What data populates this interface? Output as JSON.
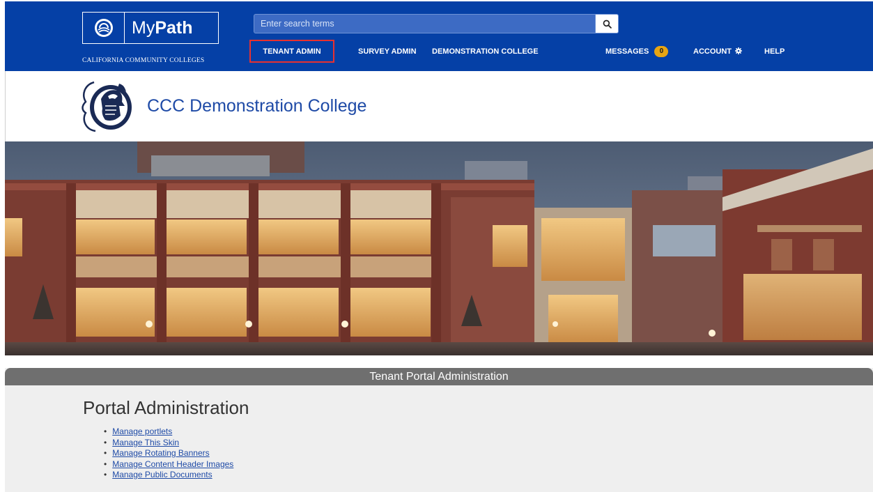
{
  "brand": {
    "logo_light": "My",
    "logo_bold": "Path",
    "logo_subtitle": "CALIFORNIA COMMUNITY COLLEGES",
    "icon": "ccc-logo-icon"
  },
  "search": {
    "placeholder": "Enter search terms",
    "icon": "search-icon"
  },
  "nav": {
    "tenant_admin": "TENANT ADMIN",
    "survey_admin": "SURVEY ADMIN",
    "demonstration_college": "DEMONSTRATION COLLEGE",
    "messages": "MESSAGES",
    "messages_count": "0",
    "account": "ACCOUNT",
    "help": "HELP"
  },
  "college": {
    "name": "CCC Demonstration College",
    "icon": "knight-crest-icon"
  },
  "panel": {
    "header": "Tenant Portal Administration",
    "title": "Portal Administration",
    "links": [
      "Manage portlets",
      "Manage This Skin",
      "Manage Rotating Banners",
      "Manage Content Header Images",
      "Manage Public Documents"
    ]
  },
  "colors": {
    "nav_blue": "#0540a6",
    "highlight_red": "#e8312f",
    "badge_gold": "#e8a512",
    "link_blue": "#1e4aa6",
    "panel_header_gray": "#6f6f6f"
  }
}
